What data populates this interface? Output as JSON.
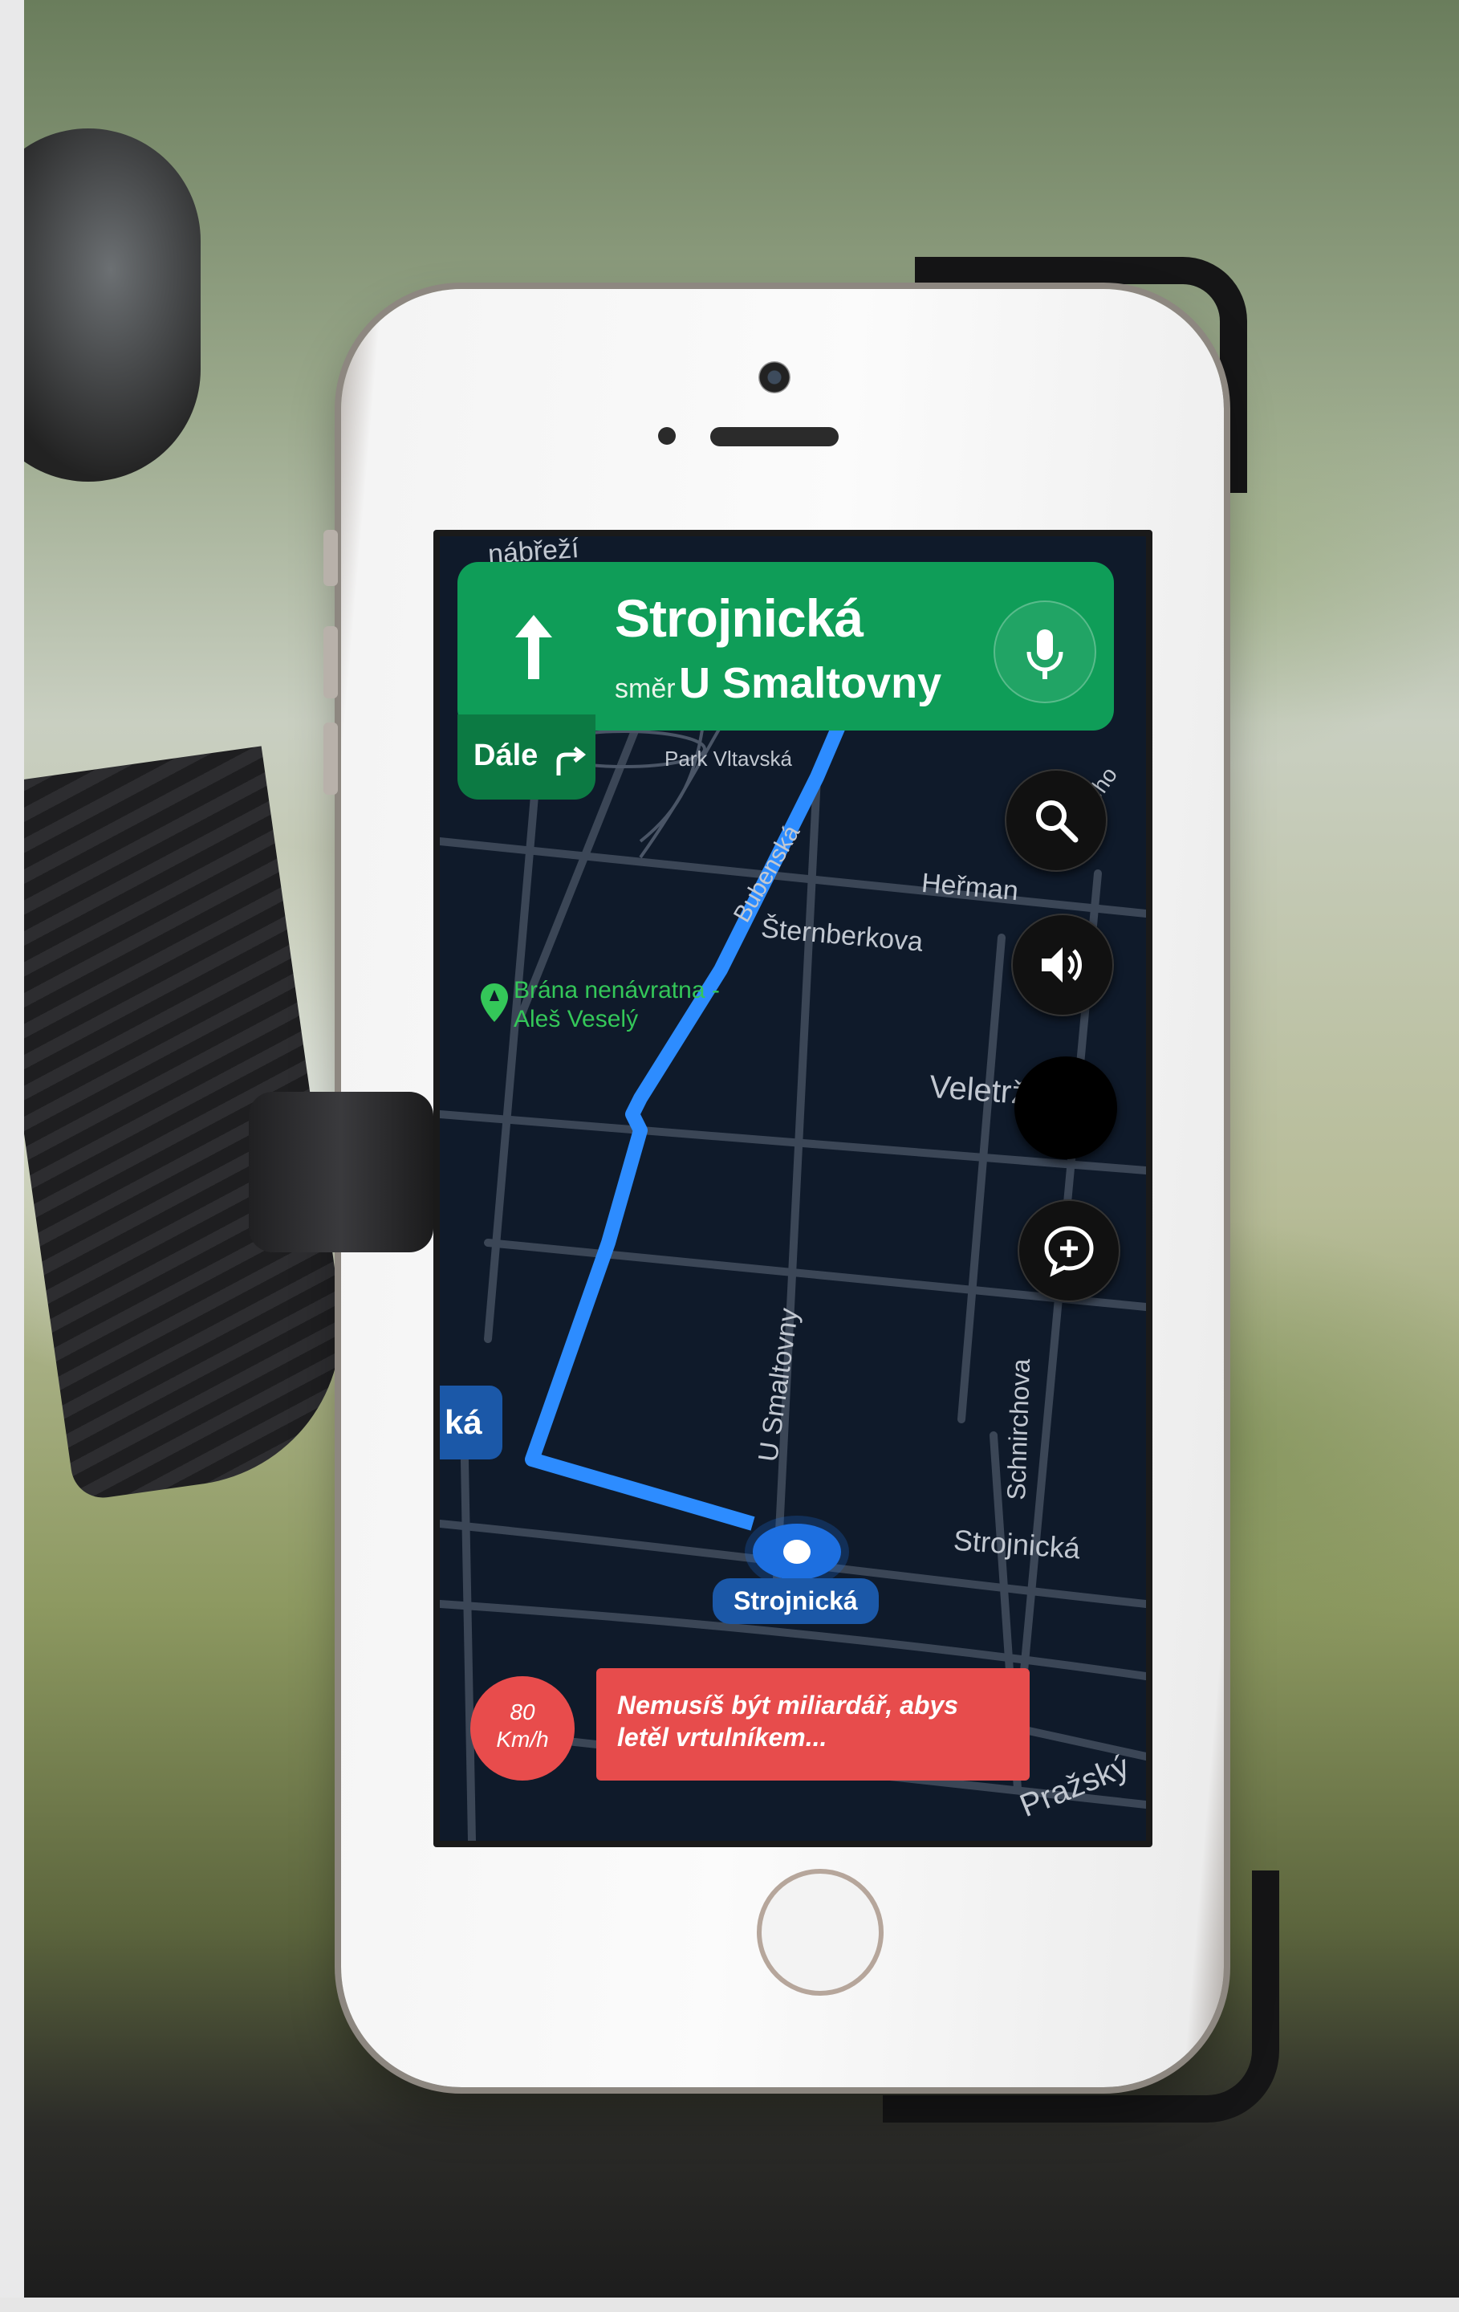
{
  "navigation": {
    "street": "Strojnická",
    "direction_prefix": "směr",
    "direction_name": "U Smaltovny",
    "next_label": "Dále"
  },
  "map": {
    "labels": {
      "park": "Park Vltavská",
      "bubenska": "Bubenská",
      "sternberkova": "Šternberkova",
      "veletrz": "Veletrž",
      "u_smaltovny": "U Smaltovny",
      "schnirchova": "Schnirchova",
      "strojnicka": "Strojnická",
      "prazsky": "Pražský",
      "nabrezi": "nábřeží",
      "herman": "Heřman",
      "keho": "kého"
    },
    "poi": "Brána nenávratna - Aleš Veselý",
    "edge_label": "ká",
    "current_street": "Strojnická",
    "route_color": "#2d8cff"
  },
  "controls": {
    "search_icon": "search-icon",
    "sound_icon": "volume-icon",
    "report_icon": "add-report-icon"
  },
  "speed": {
    "value": "80",
    "unit": "Km/h"
  },
  "ad": {
    "text": "Nemusíš být miliardář, abys letěl vrtulníkem..."
  },
  "colors": {
    "header_green": "#0f9d58",
    "map_background": "#0f1a2a",
    "alert_red": "#e74c4c"
  }
}
